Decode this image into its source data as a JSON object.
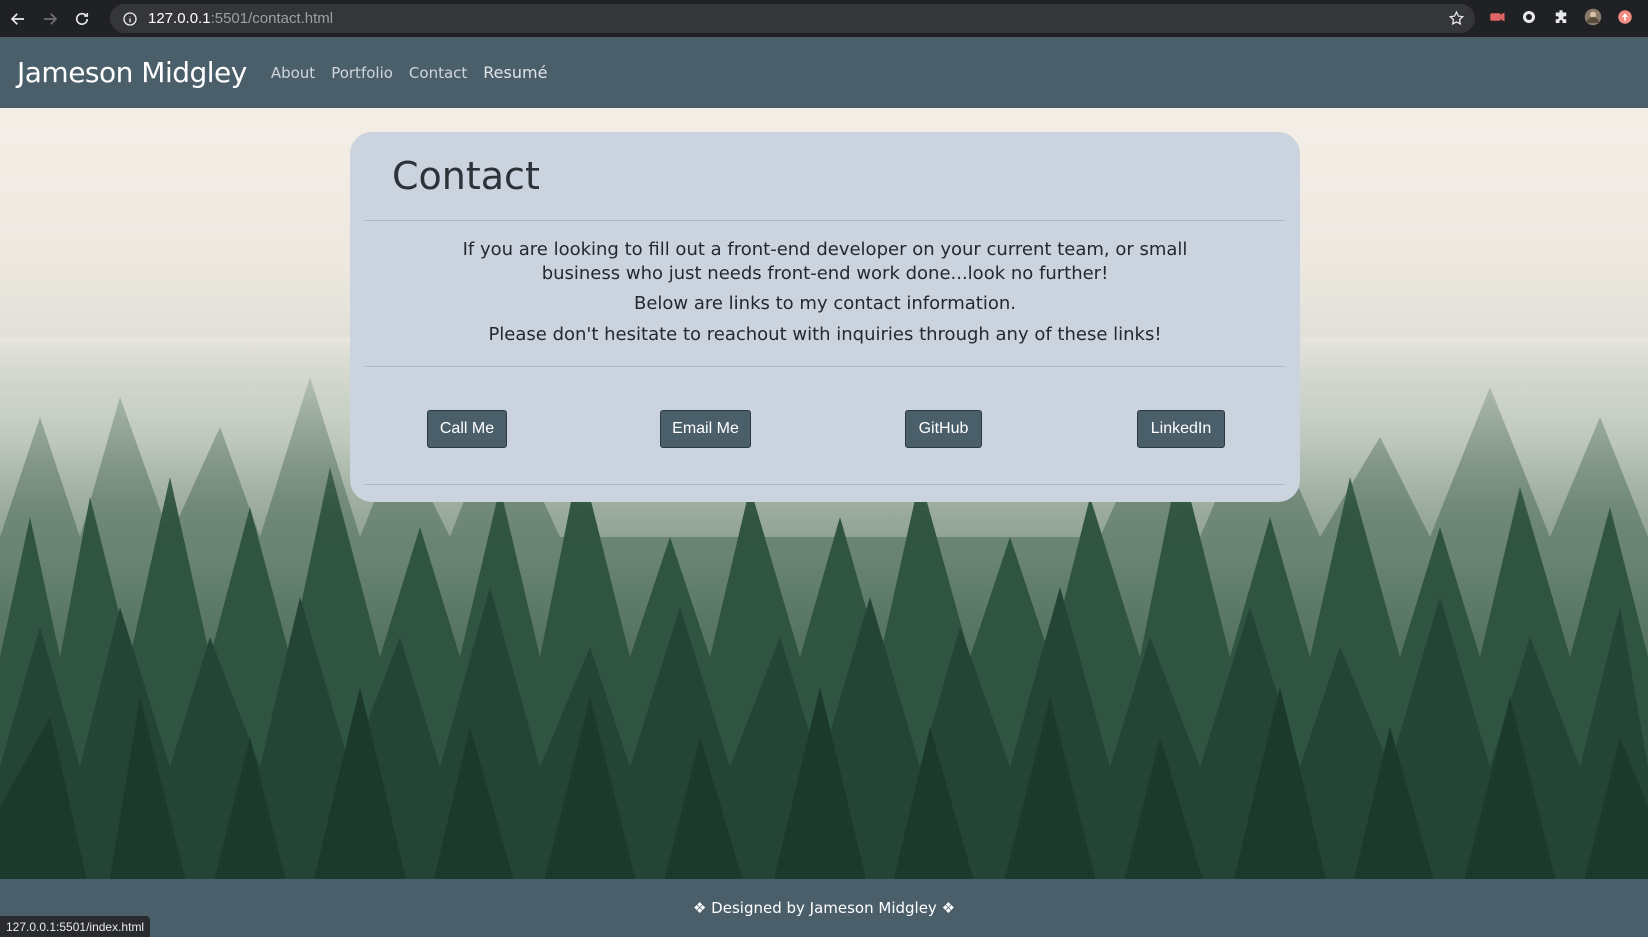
{
  "browser": {
    "url_host": "127.0.0.1",
    "url_rest": ":5501/contact.html",
    "status_url": "127.0.0.1:5501/index.html"
  },
  "nav": {
    "brand": "Jameson Midgley",
    "links": [
      "About",
      "Portfolio",
      "Contact",
      "Resumé"
    ]
  },
  "card": {
    "title": "Contact",
    "paragraph1_line1": "If you are looking to fill out a front-end developer on your current team, or small",
    "paragraph1_line2": "business who just needs front-end work done...look no further!",
    "paragraph2": "Below are links to my contact information.",
    "paragraph3": "Please don't hesitate to reachout with inquiries through any of these links!",
    "buttons": [
      "Call Me",
      "Email Me",
      "GitHub",
      "LinkedIn"
    ]
  },
  "footer": {
    "text": "❖ Designed by Jameson Midgley ❖"
  },
  "colors": {
    "navbar": "#4b5f6b",
    "card": "#cbd3de",
    "button": "#4b5f6b"
  }
}
